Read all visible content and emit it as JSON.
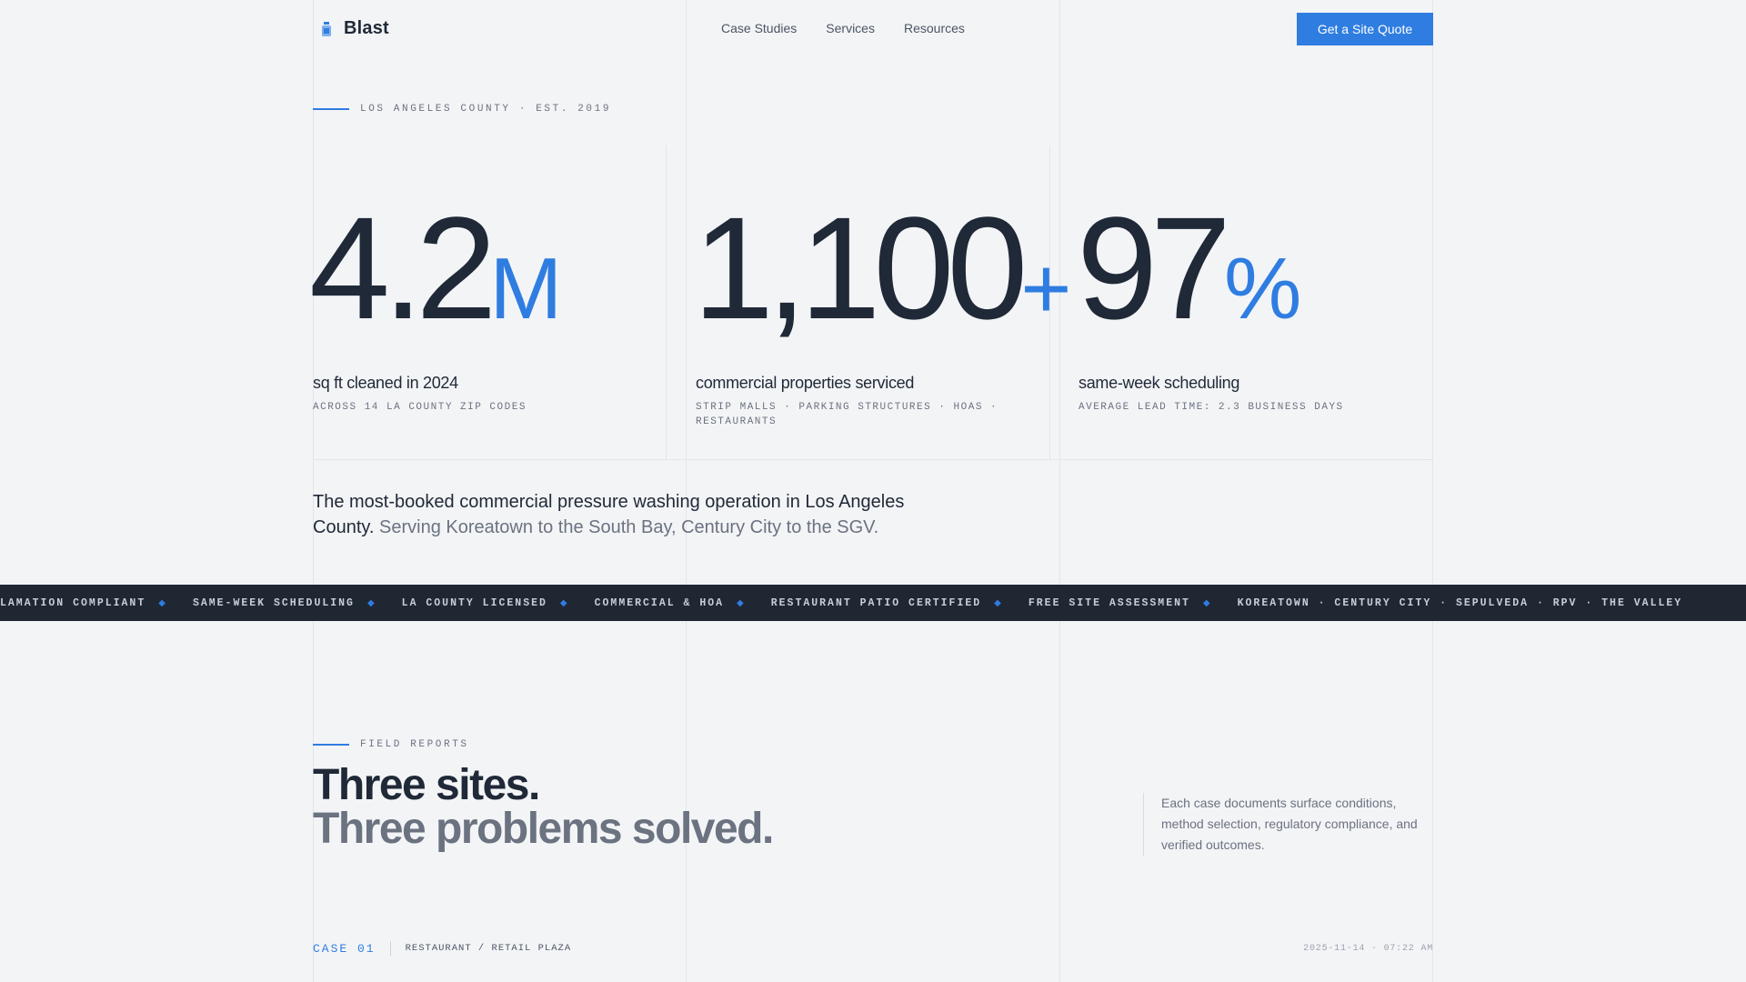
{
  "nav": {
    "brand": "Blast",
    "links": [
      "Case Studies",
      "Services",
      "Resources"
    ],
    "cta": "Get a Site Quote"
  },
  "hero": {
    "eyebrow": "LOS ANGELES COUNTY · EST. 2019",
    "stats": [
      {
        "number": "4.2",
        "suffix": "M",
        "label": "sq ft cleaned in 2024",
        "sub": "ACROSS 14 LA COUNTY ZIP CODES"
      },
      {
        "number": "1,100",
        "suffix": "+",
        "label": "commercial properties serviced",
        "sub": "STRIP MALLS · PARKING STRUCTURES · HOAS · RESTAURANTS"
      },
      {
        "number": "97",
        "suffix": "%",
        "label": "same-week scheduling",
        "sub": "AVERAGE LEAD TIME: 2.3 BUSINESS DAYS"
      }
    ],
    "tagline_main": "The most-booked commercial pressure washing operation in Los Angeles County.",
    "tagline_muted": "Serving Koreatown to the South Bay, Century City to the SGV."
  },
  "ticker": {
    "items": [
      "LAMATION COMPLIANT",
      "SAME-WEEK SCHEDULING",
      "LA COUNTY LICENSED",
      "COMMERCIAL & HOA",
      "RESTAURANT PATIO CERTIFIED",
      "FREE SITE ASSESSMENT",
      "KOREATOWN · CENTURY CITY · SEPULVEDA · RPV · THE VALLEY"
    ],
    "separator": "◆"
  },
  "field_reports": {
    "eyebrow": "FIELD REPORTS",
    "heading_line1": "Three sites.",
    "heading_line2": "Three problems solved.",
    "note": "Each case documents surface conditions, method selection, regulatory compliance, and verified outcomes.",
    "case": {
      "id": "CASE 01",
      "type": "RESTAURANT / RETAIL PLAZA",
      "timestamp": "2025-11-14 · 07:22 AM"
    }
  },
  "colors": {
    "accent": "#2f7de1",
    "text": "#1f2937",
    "muted": "#6b7280",
    "background": "#f3f4f6",
    "ticker_bg": "#1f2733"
  }
}
